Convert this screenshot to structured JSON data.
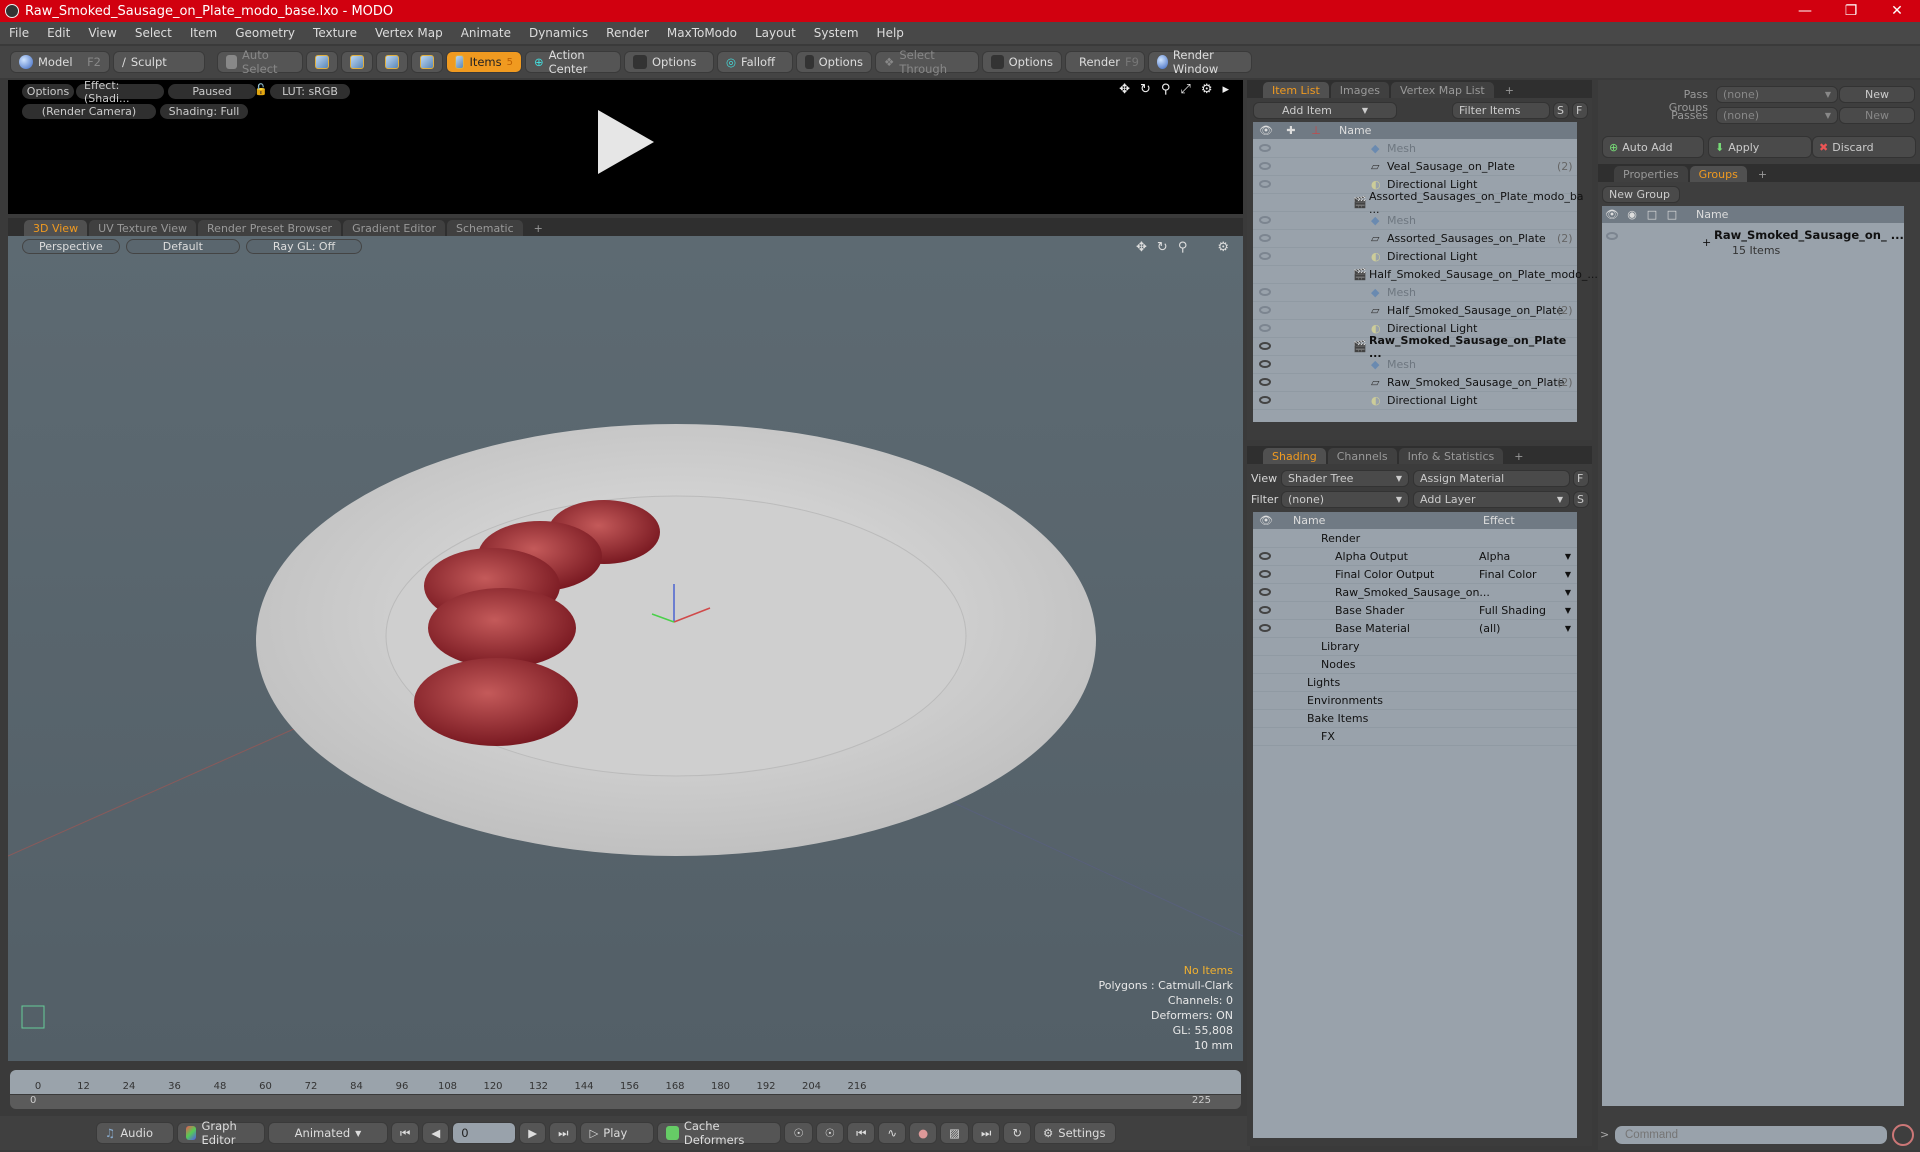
{
  "window": {
    "title": "Raw_Smoked_Sausage_on_Plate_modo_base.lxo - MODO",
    "controls": [
      "minimize",
      "maximize",
      "close"
    ]
  },
  "menu": [
    "File",
    "Edit",
    "View",
    "Select",
    "Item",
    "Geometry",
    "Texture",
    "Vertex Map",
    "Animate",
    "Dynamics",
    "Render",
    "MaxToModo",
    "Layout",
    "System",
    "Help"
  ],
  "toolbar": {
    "model": "Model",
    "model_key": "F2",
    "sculpt": "Sculpt",
    "auto_select": "Auto Select",
    "items": "Items",
    "items_count": "5",
    "action_center": "Action Center",
    "options1": "Options",
    "falloff": "Falloff",
    "options2": "Options",
    "select_through": "Select Through",
    "options3": "Options",
    "render": "Render",
    "render_key": "F9",
    "render_window": "Render Window"
  },
  "preview": {
    "options": "Options",
    "effect": "Effect: (Shadi...",
    "paused": "Paused",
    "lut": "LUT: sRGB",
    "camera": "(Render Camera)",
    "shading": "Shading: Full"
  },
  "viewport_tabs": [
    "3D View",
    "UV Texture View",
    "Render Preset Browser",
    "Gradient Editor",
    "Schematic",
    "+"
  ],
  "viewport": {
    "perspective": "Perspective",
    "default": "Default",
    "raygl": "Ray GL: Off",
    "stats": {
      "selection": "No Items",
      "polygons": "Polygons : Catmull-Clark",
      "channels": "Channels: 0",
      "deformers": "Deformers: ON",
      "gl": "GL: 55,808",
      "unit": "10 mm"
    }
  },
  "timeline": {
    "ticks": [
      "0",
      "12",
      "24",
      "36",
      "48",
      "60",
      "72",
      "84",
      "96",
      "108",
      "120",
      "132",
      "144",
      "156",
      "168",
      "180",
      "192",
      "204",
      "216"
    ],
    "start": "0",
    "end": "225",
    "end2": "225"
  },
  "bottombar": {
    "audio": "Audio",
    "graph_editor": "Graph Editor",
    "animated": "Animated",
    "frame": "0",
    "play": "Play",
    "cache": "Cache Deformers",
    "settings": "Settings"
  },
  "itemlist": {
    "tabs": [
      "Item List",
      "Images",
      "Vertex Map List",
      "+"
    ],
    "add_item": "Add Item",
    "filter": "Filter Items",
    "s": "S",
    "f": "F",
    "col_name": "Name",
    "rows": [
      {
        "label": "Mesh",
        "indent": 3,
        "kind": "mesh",
        "eye": "dim"
      },
      {
        "label": "Veal_Sausage_on_Plate",
        "count": "(2)",
        "indent": 3,
        "kind": "group",
        "eye": "dim"
      },
      {
        "label": "Directional Light",
        "indent": 3,
        "kind": "light",
        "eye": "dim"
      },
      {
        "label": "Assorted_Sausages_on_Plate_modo_ba ...",
        "indent": 2,
        "kind": "scene",
        "eye": "none"
      },
      {
        "label": "Mesh",
        "indent": 3,
        "kind": "mesh",
        "eye": "dim"
      },
      {
        "label": "Assorted_Sausages_on_Plate",
        "count": "(2)",
        "indent": 3,
        "kind": "group",
        "eye": "dim"
      },
      {
        "label": "Directional Light",
        "indent": 3,
        "kind": "light",
        "eye": "dim"
      },
      {
        "label": "Half_Smoked_Sausage_on_Plate_modo_...",
        "indent": 2,
        "kind": "scene",
        "eye": "none"
      },
      {
        "label": "Mesh",
        "indent": 3,
        "kind": "mesh",
        "eye": "dim"
      },
      {
        "label": "Half_Smoked_Sausage_on_Plate",
        "count": "(2)",
        "indent": 3,
        "kind": "group",
        "eye": "dim"
      },
      {
        "label": "Directional Light",
        "indent": 3,
        "kind": "light",
        "eye": "dim"
      },
      {
        "label": "Raw_Smoked_Sausage_on_Plate ...",
        "indent": 2,
        "kind": "scene",
        "eye": "on",
        "bold": true
      },
      {
        "label": "Mesh",
        "indent": 3,
        "kind": "mesh",
        "eye": "on"
      },
      {
        "label": "Raw_Smoked_Sausage_on_Plate",
        "count": "(2)",
        "indent": 3,
        "kind": "group",
        "eye": "on"
      },
      {
        "label": "Directional Light",
        "indent": 3,
        "kind": "light",
        "eye": "on"
      }
    ]
  },
  "shading": {
    "tabs": [
      "Shading",
      "Channels",
      "Info & Statistics",
      "+"
    ],
    "view_label": "View",
    "view_value": "Shader Tree",
    "assign": "Assign Material",
    "f": "F",
    "filter_label": "Filter",
    "filter_value": "(none)",
    "add_layer": "Add Layer",
    "s": "S",
    "col_name": "Name",
    "col_effect": "Effect",
    "rows": [
      {
        "label": "Render",
        "effect": "",
        "indent": 1,
        "eye": false
      },
      {
        "label": "Alpha Output",
        "effect": "Alpha",
        "indent": 2,
        "eye": true
      },
      {
        "label": "Final Color Output",
        "effect": "Final Color",
        "indent": 2,
        "eye": true
      },
      {
        "label": "Raw_Smoked_Sausage_on...",
        "effect": "",
        "indent": 2,
        "eye": true
      },
      {
        "label": "Base Shader",
        "effect": "Full Shading",
        "indent": 2,
        "eye": true
      },
      {
        "label": "Base Material",
        "effect": "(all)",
        "indent": 2,
        "eye": true
      },
      {
        "label": "Library",
        "effect": "",
        "indent": 1,
        "eye": false
      },
      {
        "label": "Nodes",
        "effect": "",
        "indent": 1,
        "eye": false
      },
      {
        "label": "Lights",
        "effect": "",
        "indent": 0,
        "eye": false
      },
      {
        "label": "Environments",
        "effect": "",
        "indent": 0,
        "eye": false
      },
      {
        "label": "Bake Items",
        "effect": "",
        "indent": 0,
        "eye": false
      },
      {
        "label": "FX",
        "effect": "",
        "indent": 1,
        "eye": false
      }
    ]
  },
  "passes": {
    "pass_groups_label": "Pass Groups",
    "pass_groups_value": "(none)",
    "new1": "New",
    "passes_label": "Passes",
    "passes_value": "(none)",
    "new2": "New",
    "auto_add": "Auto Add",
    "apply": "Apply",
    "discard": "Discard"
  },
  "groups": {
    "tabs": [
      "Properties",
      "Groups",
      "+"
    ],
    "new_group": "New Group",
    "col_name": "Name",
    "item_name": "Raw_Smoked_Sausage_on_ ...",
    "item_count": "15 Items"
  },
  "command": {
    "placeholder": "Command"
  }
}
